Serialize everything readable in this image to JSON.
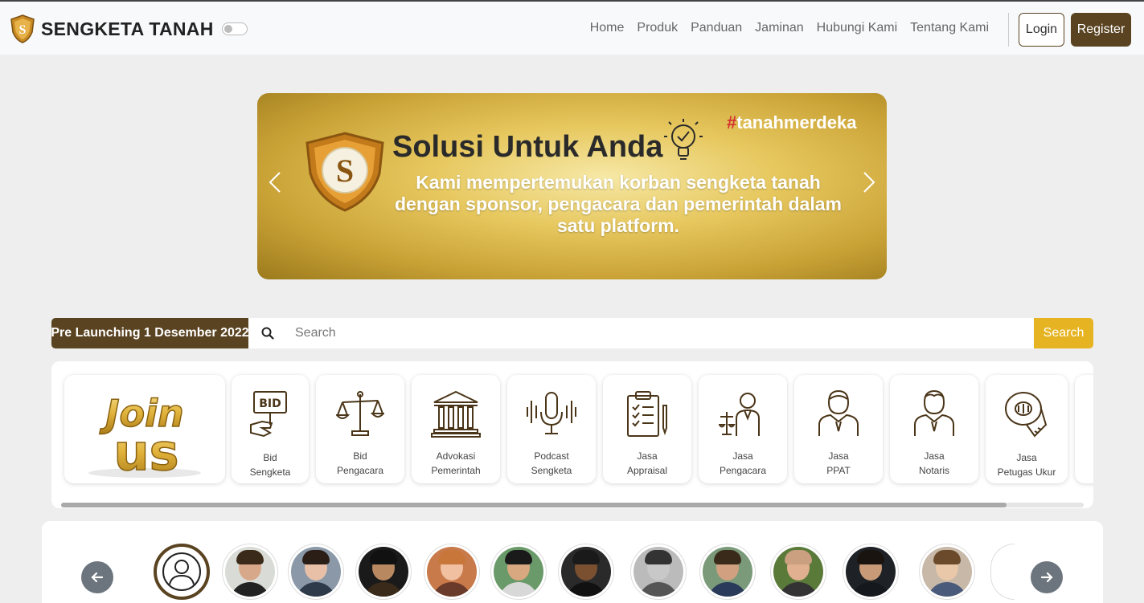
{
  "brand": {
    "name": "SENGKETA TANAH"
  },
  "nav": {
    "links": [
      "Home",
      "Produk",
      "Panduan",
      "Jaminan",
      "Hubungi Kami",
      "Tentang Kami"
    ],
    "login": "Login",
    "register": "Register"
  },
  "banner": {
    "title": "Solusi Untuk Anda",
    "hashtag_symbol": "#",
    "hashtag_text": "tanahmerdeka",
    "description": "Kami mempertemukan korban sengketa tanah dengan sponsor, pengacara dan pemerintah dalam satu platform."
  },
  "search": {
    "prelaunch": "Pre Launching 1 Desember 2022",
    "placeholder": "Search",
    "button": "Search"
  },
  "services": {
    "joinus_text": "Join us",
    "items": [
      {
        "line1": "Bid",
        "line2": "Sengketa",
        "icon": "bid-icon"
      },
      {
        "line1": "Bid",
        "line2": "Pengacara",
        "icon": "scales-icon"
      },
      {
        "line1": "Advokasi",
        "line2": "Pemerintah",
        "icon": "government-building-icon"
      },
      {
        "line1": "Podcast",
        "line2": "Sengketa",
        "icon": "microphone-icon"
      },
      {
        "line1": "Jasa",
        "line2": "Appraisal",
        "icon": "clipboard-icon"
      },
      {
        "line1": "Jasa",
        "line2": "Pengacara",
        "icon": "lawyer-icon"
      },
      {
        "line1": "Jasa",
        "line2": "PPAT",
        "icon": "person-tie-icon"
      },
      {
        "line1": "Jasa",
        "line2": "Notaris",
        "icon": "person-tie-icon"
      },
      {
        "line1": "Jasa",
        "line2": "Petugas Ukur",
        "icon": "measuring-tape-icon"
      }
    ]
  },
  "colors": {
    "primary_brown": "#5a4321",
    "accent_gold": "#e6b422",
    "hashtag_red": "#d32f2f"
  }
}
